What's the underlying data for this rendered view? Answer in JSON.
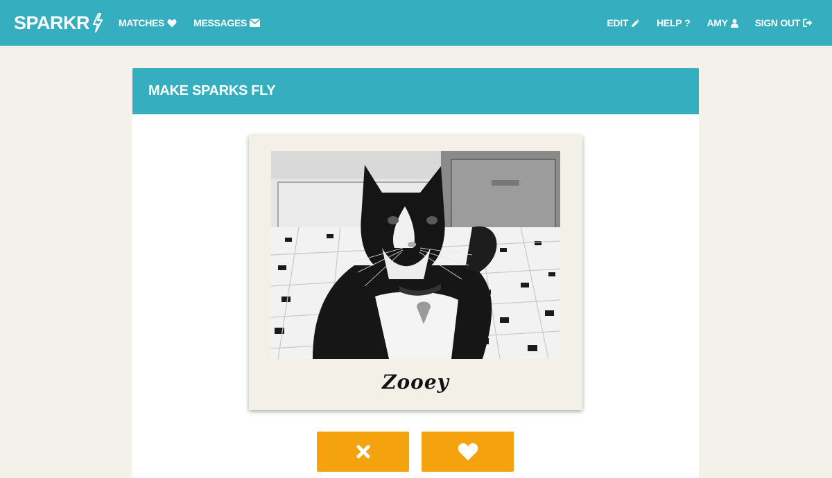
{
  "nav": {
    "brand": "SPARKR",
    "left_links": [
      {
        "label": "MATCHES",
        "icon": "heart-icon"
      },
      {
        "label": "MESSAGES",
        "icon": "envelope-icon"
      }
    ],
    "right_links": [
      {
        "label": "EDIT",
        "icon": "pencil-icon"
      },
      {
        "label": "HELP",
        "icon": "question-icon"
      },
      {
        "label": "AMY",
        "icon": "user-icon"
      },
      {
        "label": "SIGN OUT",
        "icon": "sign-out-icon"
      }
    ]
  },
  "panel": {
    "title": "MAKE SPARKS FLY"
  },
  "profile": {
    "name": "Zooey"
  },
  "actions": {
    "reject_icon": "times-icon",
    "like_icon": "heart-icon"
  },
  "colors": {
    "brand": "#35afc0",
    "background": "#f4f1ea",
    "action": "#f4a30e"
  }
}
